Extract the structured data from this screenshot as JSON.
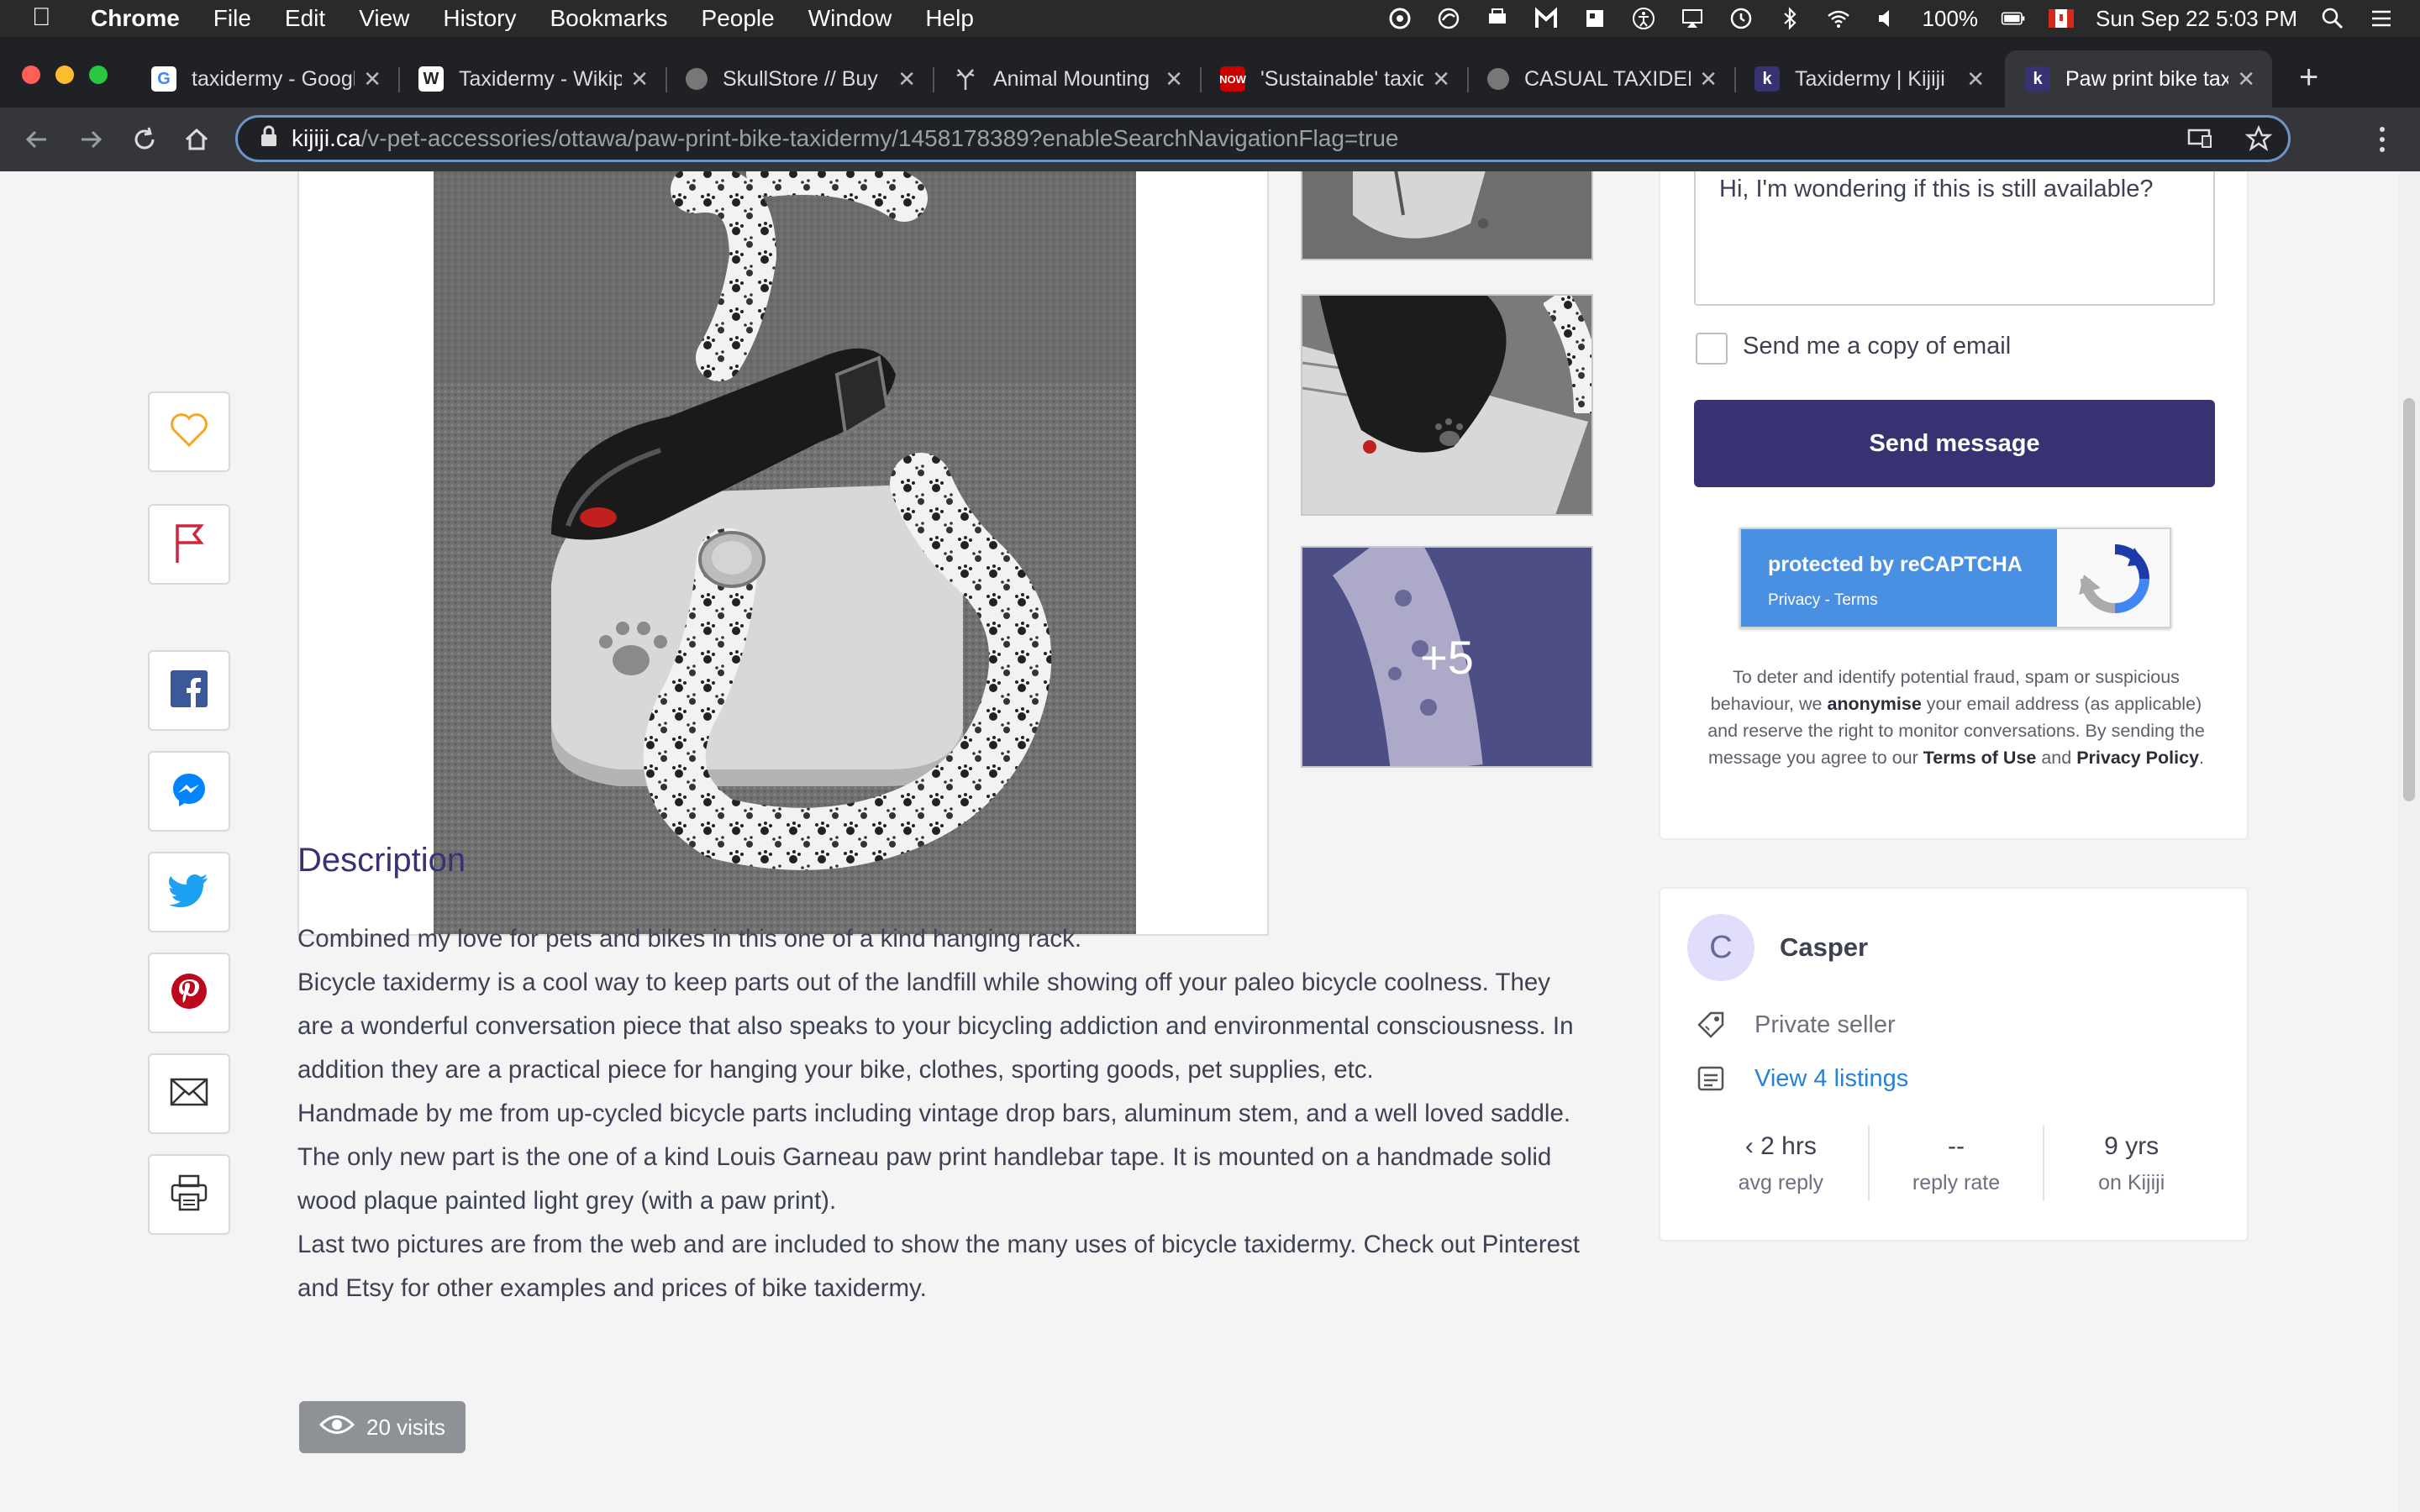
{
  "menubar": {
    "app": "Chrome",
    "menus": [
      "File",
      "Edit",
      "View",
      "History",
      "Bookmarks",
      "People",
      "Window",
      "Help"
    ],
    "battery": "100%",
    "datetime": "Sun Sep 22  5:03 PM"
  },
  "tabs": [
    {
      "title": "taxidermy - Google",
      "favicon": "google-icon"
    },
    {
      "title": "Taxidermy - Wikipedia",
      "favicon": "wikipedia-icon"
    },
    {
      "title": "SkullStore // Buy",
      "favicon": "globe-icon"
    },
    {
      "title": "Animal Mounting",
      "favicon": "antlers-icon"
    },
    {
      "title": "'Sustainable' taxidermy",
      "favicon": "now-icon"
    },
    {
      "title": "CASUAL TAXIDERMY",
      "favicon": "globe-icon"
    },
    {
      "title": "Taxidermy | Kijiji",
      "favicon": "kijiji-icon"
    },
    {
      "title": "Paw print bike taxidermy",
      "favicon": "kijiji-icon",
      "active": true
    }
  ],
  "address": {
    "host": "kijiji.ca",
    "path": "/v-pet-accessories/ottawa/paw-print-bike-taxidermy/1458178389?enableSearchNavigationFlag=true"
  },
  "gallery": {
    "more_count": "+5"
  },
  "description": {
    "title": "Description",
    "paragraphs": [
      "Combined my love for pets and bikes in this one of a kind hanging rack.",
      "Bicycle taxidermy is a cool way to keep parts out of the landfill while showing off your paleo bicycle coolness. They are a wonderful conversation piece that also speaks to your bicycling addiction and environmental consciousness. In addition they are a practical piece for hanging your bike, clothes, sporting goods, pet supplies, etc.",
      "Handmade by me from up-cycled bicycle parts including vintage drop bars, aluminum stem, and a well loved saddle. The only new part is the one of a kind Louis Garneau paw print handlebar tape. It is mounted on a handmade solid wood plaque painted light grey (with a paw print).",
      "Last two pictures are from the web and are included to show the many uses of bicycle taxidermy. Check out Pinterest and Etsy for other examples and prices of bike taxidermy."
    ]
  },
  "visits": "20 visits",
  "message": {
    "text": "Hi, I'm wondering if this is still available?",
    "copy_label": "Send me a copy of email",
    "send_label": "Send message"
  },
  "recaptcha": {
    "protected_by": "protected by ",
    "brand": "reCAPTCHA",
    "privacy": "Privacy",
    "sep": " - ",
    "terms": "Terms"
  },
  "disclaimer": {
    "part1": "To deter and identify potential fraud, spam or suspicious behaviour, we ",
    "anonymise": "anonymise",
    "part2": " your email address (as applicable) and reserve the right to monitor conversations. By sending the message you agree to our ",
    "terms": "Terms of Use",
    "and": " and ",
    "privacy": "Privacy Policy",
    "end": "."
  },
  "seller": {
    "initial": "C",
    "name": "Casper",
    "type": "Private seller",
    "listings": "View 4 listings",
    "stats": [
      {
        "value": "‹ 2 hrs",
        "label": "avg reply"
      },
      {
        "value": "--",
        "label": "reply rate"
      },
      {
        "value": "9 yrs",
        "label": "on Kijiji"
      }
    ]
  },
  "colors": {
    "kijiji_purple": "#373373",
    "link_blue": "#2681db",
    "recaptcha_blue": "#4a90e2"
  }
}
